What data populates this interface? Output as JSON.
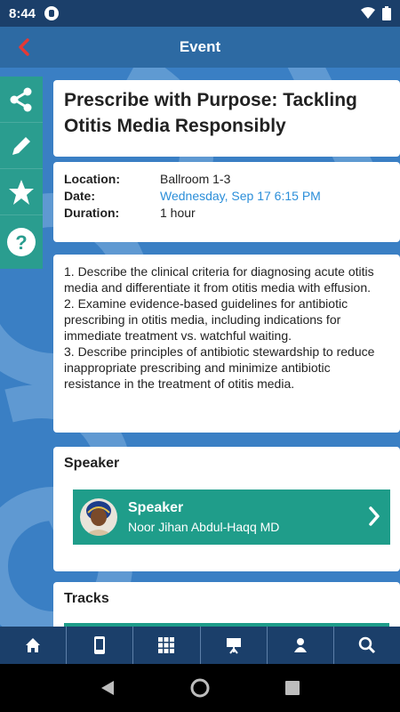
{
  "status": {
    "time": "8:44"
  },
  "header": {
    "title": "Event"
  },
  "event": {
    "title": "Prescribe with Purpose: Tackling Otitis Media Responsibly",
    "location_label": "Location:",
    "location": "Ballroom 1-3",
    "date_label": "Date:",
    "date": "Wednesday, Sep 17 6:15 PM",
    "duration_label": "Duration:",
    "duration": "1 hour",
    "description": [
      "1. Describe the clinical criteria for diagnosing acute otitis media and differentiate it from otitis media with effusion.",
      "2. Examine evidence-based guidelines for antibiotic prescribing in otitis media, including indications for immediate treatment vs. watchful waiting.",
      "3. Describe principles of antibiotic stewardship to reduce inappropriate prescribing and minimize antibiotic resistance in the treatment of otitis media."
    ]
  },
  "speaker_section": {
    "heading": "Speaker",
    "role": "Speaker",
    "name": "Noor Jihan Abdul-Haqq MD"
  },
  "tracks_section": {
    "heading": "Tracks"
  },
  "side_actions": [
    "share-icon",
    "edit-icon",
    "star-icon",
    "help-icon"
  ],
  "bottom_nav": [
    "home-icon",
    "phone-icon",
    "grid-icon",
    "presentation-icon",
    "sponsor-icon",
    "search-icon"
  ],
  "colors": {
    "primary": "#2d6aa3",
    "teal": "#1f9d8a",
    "link": "#2b8ed9",
    "back": "#e53935"
  }
}
